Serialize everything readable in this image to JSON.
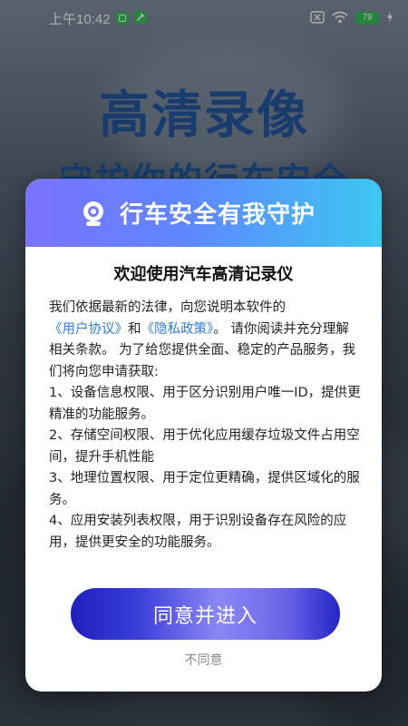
{
  "status_bar": {
    "time": "上午10:42",
    "battery": "79"
  },
  "background": {
    "title": "高清录像",
    "subtitle": "守护你的行车安全"
  },
  "dialog": {
    "header_title": "行车安全有我守护",
    "title": "欢迎使用汽车高清记录仪",
    "intro_1": "我们依据最新的法律，向您说明本软件的",
    "link_user_agreement": "《用户协议》",
    "and": "和",
    "link_privacy_policy": "《隐私政策》",
    "intro_2": "。 请你阅读并充分理解相关条款。 为了给您提供全面、稳定的产品服务，我们将向您申请获取:",
    "items": [
      "1、设备信息权限、用于区分识别用户唯一ID，提供更精准的功能服务。",
      "2、存储空间权限、用于优化应用缓存垃圾文件占用空间，提升手机性能",
      "3、地理位置权限、用于定位更精确，提供区域化的服务。",
      "4、应用安装列表权限，用于识别设备存在风险的应用，提供更安全的功能服务。"
    ],
    "agree_label": "同意并进入",
    "disagree_label": "不同意"
  },
  "colors": {
    "header_gradient_start": "#7a73ff",
    "header_gradient_end": "#3cc8f0",
    "link": "#2f7de0",
    "button_primary": "#2525c8",
    "hero_text": "#1a4f95"
  }
}
